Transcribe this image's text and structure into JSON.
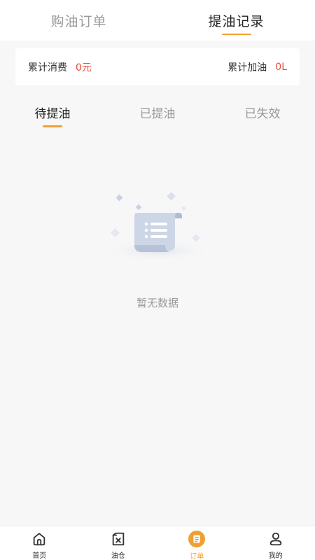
{
  "top_tabs": [
    {
      "label": "购油订单",
      "active": false
    },
    {
      "label": "提油记录",
      "active": true
    }
  ],
  "summary": {
    "consumption_label": "累计消费",
    "consumption_value": "0元",
    "refuel_label": "累计加油",
    "refuel_value": "0L"
  },
  "sub_tabs": [
    {
      "label": "待提油",
      "active": true
    },
    {
      "label": "已提油",
      "active": false
    },
    {
      "label": "已失效",
      "active": false
    }
  ],
  "empty_state": {
    "text": "暂无数据",
    "icon": "empty-document-icon"
  },
  "bottom_nav": [
    {
      "label": "首页",
      "icon": "home-icon",
      "active": false
    },
    {
      "label": "油仓",
      "icon": "oil-tank-icon",
      "active": false
    },
    {
      "label": "订单",
      "icon": "order-icon",
      "active": true
    },
    {
      "label": "我的",
      "icon": "profile-icon",
      "active": false
    }
  ],
  "colors": {
    "accent": "#f0a030",
    "value_red": "#e8493c",
    "background": "#f7f7f7"
  }
}
